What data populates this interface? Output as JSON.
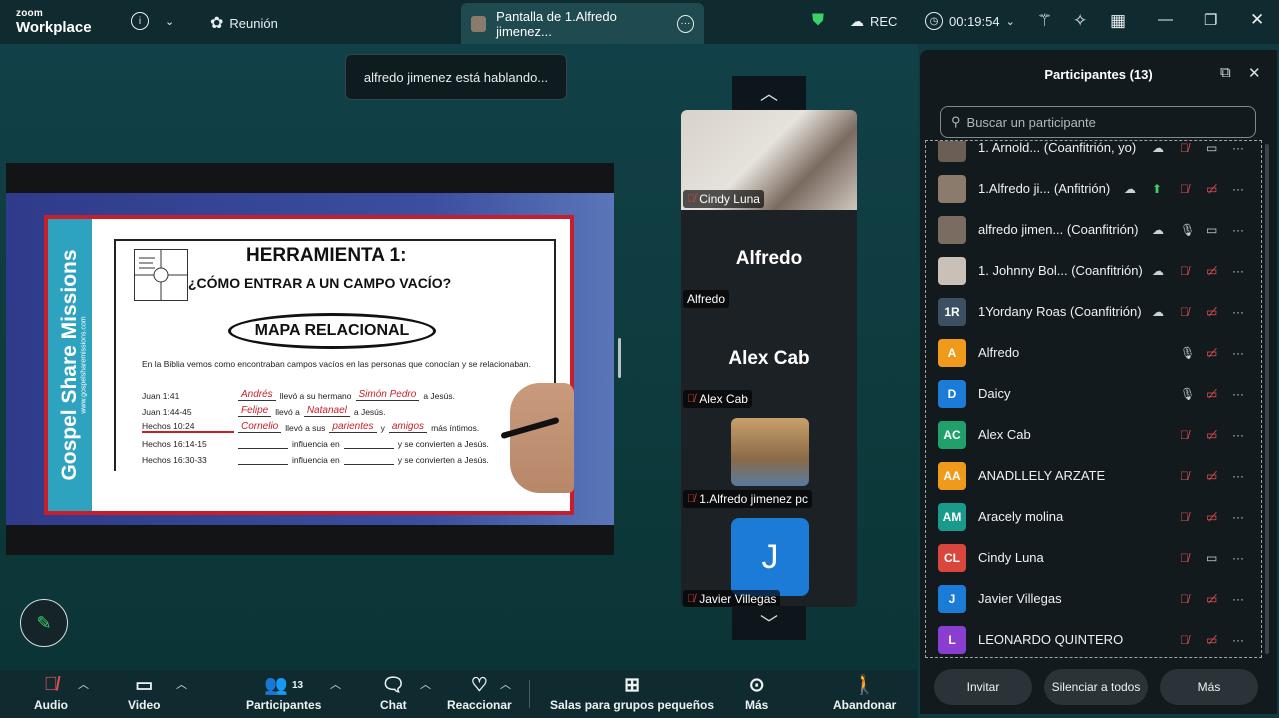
{
  "titlebar": {
    "logo_line1": "zoom",
    "logo_line2": "Workplace",
    "meeting_label": "Reunión",
    "share_tab": "Pantalla de 1.Alfredo jimenez...",
    "rec_label": "REC",
    "timer": "00:19:54"
  },
  "toast": "alfredo jimenez está hablando...",
  "slide": {
    "band": "Gospel Share Missions",
    "band_url": "www.gospelsharemissions.com",
    "title": "HERRAMIENTA 1:",
    "subtitle": "¿CÓMO ENTRAR A UN CAMPO VACÍO?",
    "oval": "MAPA RELACIONAL",
    "intro": "En la Biblia vemos como encontraban campos vacíos en las personas que conocían y se relacionaban.",
    "rows": [
      {
        "ref": "Juan 1:41",
        "a": "Andrés",
        "mid": "llevó a su hermano",
        "b": "Simón Pedro",
        "end": "a Jesús."
      },
      {
        "ref": "Juan 1:44-45",
        "a": "Felipe",
        "mid": "llevó a",
        "b": "Natanael",
        "end": "a Jesús."
      },
      {
        "ref": "Hechos 10:24",
        "a": "Cornelio",
        "mid": "llevó a sus",
        "b": "parientes",
        "y": "y",
        "c": "amigos",
        "end": "más íntimos."
      },
      {
        "ref": "Hechos 16:14-15",
        "mid": "influencia en",
        "end": "y se convierten a Jesús."
      },
      {
        "ref": "Hechos 16:30-33",
        "mid": "influencia en",
        "end": "y se convierten a Jesús."
      }
    ]
  },
  "videos": [
    {
      "name": "Cindy Luna"
    },
    {
      "big": "Alfredo",
      "name": "Alfredo"
    },
    {
      "big": "Alex Cab",
      "name": "Alex Cab"
    },
    {
      "name": "1.Alfredo jimenez pc"
    },
    {
      "avatar": "J",
      "name": "Javier Villegas"
    }
  ],
  "panel": {
    "title": "Participantes (13)",
    "search_placeholder": "Buscar un participante",
    "participants": [
      {
        "initials": "",
        "name": "1. Arnold...  (Coanfitrión, yo)",
        "color": "#6b5e55"
      },
      {
        "initials": "",
        "name": "1.Alfredo ji... (Anfitrión)",
        "color": "#8a7b6d"
      },
      {
        "initials": "",
        "name": "alfredo jimen... (Coanfitrión)",
        "color": "#7a6c60"
      },
      {
        "initials": "",
        "name": "1. Johnny Bol... (Coanfitrión)",
        "color": "#c9c1b8"
      },
      {
        "initials": "1R",
        "name": "1Yordany Roas (Coanfitrión)",
        "color": "#3c4f63"
      },
      {
        "initials": "A",
        "name": "Alfredo",
        "color": "#f09a1c"
      },
      {
        "initials": "D",
        "name": "Daicy",
        "color": "#1d7bd8"
      },
      {
        "initials": "AC",
        "name": "Alex Cab",
        "color": "#22a06b"
      },
      {
        "initials": "AA",
        "name": "ANADLLELY ARZATE",
        "color": "#f09a1c"
      },
      {
        "initials": "AM",
        "name": "Aracely molina",
        "color": "#1a9a8a"
      },
      {
        "initials": "CL",
        "name": "Cindy Luna",
        "color": "#d9463e"
      },
      {
        "initials": "J",
        "name": "Javier Villegas",
        "color": "#1d7bd8"
      },
      {
        "initials": "L",
        "name": "LEONARDO QUINTERO",
        "color": "#8a3fd0"
      }
    ],
    "buttons": [
      "Invitar",
      "Silenciar a todos",
      "Más"
    ]
  },
  "toolbar": {
    "audio": "Audio",
    "video": "Video",
    "participants": "Participantes",
    "participants_count": "13",
    "chat": "Chat",
    "react": "Reaccionar",
    "rooms": "Salas para grupos pequeños",
    "more": "Más",
    "leave": "Abandonar"
  }
}
